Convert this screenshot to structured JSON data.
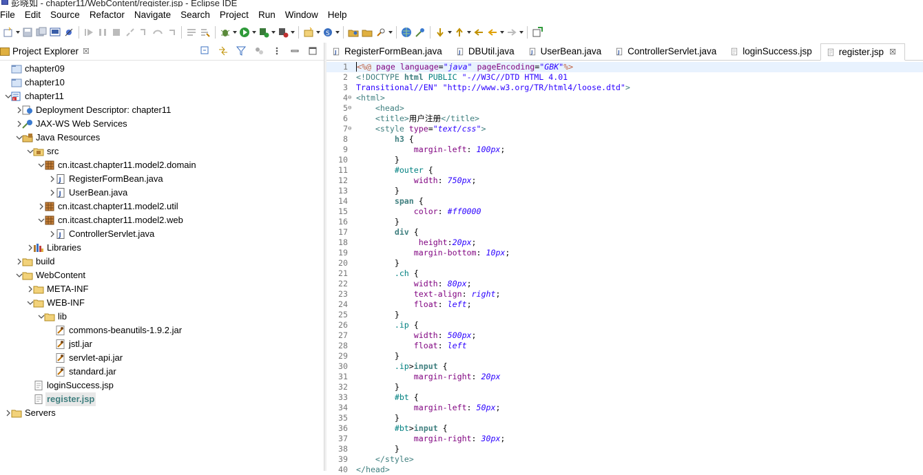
{
  "window": {
    "title": "彭晓如 - chapter11/WebContent/register.jsp - Eclipse IDE"
  },
  "menu": [
    "File",
    "Edit",
    "Source",
    "Refactor",
    "Navigate",
    "Search",
    "Project",
    "Run",
    "Window",
    "Help"
  ],
  "explorer": {
    "title": "Project Explorer",
    "close": "☒",
    "tree": [
      {
        "label": "chapter09",
        "icon": "project-folder",
        "level": 0,
        "toggle": ""
      },
      {
        "label": "chapter10",
        "icon": "project-folder",
        "level": 0,
        "toggle": ""
      },
      {
        "label": "chapter11",
        "icon": "web-project",
        "level": 0,
        "toggle": "v"
      },
      {
        "label": "Deployment Descriptor: chapter11",
        "icon": "descriptor",
        "level": 1,
        "toggle": ">"
      },
      {
        "label": "JAX-WS Web Services",
        "icon": "web-services",
        "level": 1,
        "toggle": ">"
      },
      {
        "label": "Java Resources",
        "icon": "java-resources",
        "level": 1,
        "toggle": "v"
      },
      {
        "label": "src",
        "icon": "source-folder",
        "level": 2,
        "toggle": "v"
      },
      {
        "label": "cn.itcast.chapter11.model2.domain",
        "icon": "package",
        "level": 3,
        "toggle": "v"
      },
      {
        "label": "RegisterFormBean.java",
        "icon": "java-file",
        "level": 4,
        "toggle": ">"
      },
      {
        "label": "UserBean.java",
        "icon": "java-file",
        "level": 4,
        "toggle": ">"
      },
      {
        "label": "cn.itcast.chapter11.model2.util",
        "icon": "package",
        "level": 3,
        "toggle": ">"
      },
      {
        "label": "cn.itcast.chapter11.model2.web",
        "icon": "package",
        "level": 3,
        "toggle": "v"
      },
      {
        "label": "ControllerServlet.java",
        "icon": "java-file",
        "level": 4,
        "toggle": ">"
      },
      {
        "label": "Libraries",
        "icon": "libraries",
        "level": 2,
        "toggle": ">"
      },
      {
        "label": "build",
        "icon": "folder",
        "level": 1,
        "toggle": ">"
      },
      {
        "label": "WebContent",
        "icon": "folder",
        "level": 1,
        "toggle": "v"
      },
      {
        "label": "META-INF",
        "icon": "folder",
        "level": 2,
        "toggle": ">"
      },
      {
        "label": "WEB-INF",
        "icon": "folder",
        "level": 2,
        "toggle": "v"
      },
      {
        "label": "lib",
        "icon": "folder",
        "level": 3,
        "toggle": "v"
      },
      {
        "label": "commons-beanutils-1.9.2.jar",
        "icon": "jar",
        "level": 4,
        "toggle": ""
      },
      {
        "label": "jstl.jar",
        "icon": "jar",
        "level": 4,
        "toggle": ""
      },
      {
        "label": "servlet-api.jar",
        "icon": "jar",
        "level": 4,
        "toggle": ""
      },
      {
        "label": "standard.jar",
        "icon": "jar",
        "level": 4,
        "toggle": ""
      },
      {
        "label": "loginSuccess.jsp",
        "icon": "jsp-file",
        "level": 2,
        "toggle": ""
      },
      {
        "label": "register.jsp",
        "icon": "jsp-file",
        "level": 2,
        "toggle": "",
        "selected": true
      },
      {
        "label": "Servers",
        "icon": "folder",
        "level": 0,
        "toggle": ">"
      }
    ]
  },
  "tabs": [
    {
      "label": "RegisterFormBean.java",
      "icon": "java-file"
    },
    {
      "label": "DBUtil.java",
      "icon": "java-file"
    },
    {
      "label": "UserBean.java",
      "icon": "java-file"
    },
    {
      "label": "ControllerServlet.java",
      "icon": "java-file"
    },
    {
      "label": "loginSuccess.jsp",
      "icon": "jsp-file"
    },
    {
      "label": "register.jsp",
      "icon": "jsp-file",
      "active": true,
      "close": "☒"
    }
  ],
  "code": [
    {
      "n": "1",
      "f": "",
      "tokens": [
        [
          "jsp",
          "<%@ "
        ],
        [
          "a",
          "page "
        ],
        [
          "prop",
          "language"
        ],
        [
          "d",
          "="
        ],
        [
          "val",
          "\"java\" "
        ],
        [
          "prop",
          "pageEncoding"
        ],
        [
          "d",
          "="
        ],
        [
          "val",
          "\"GBK\""
        ],
        [
          "jsp",
          "%>"
        ]
      ]
    },
    {
      "n": "2",
      "f": "",
      "tokens": [
        [
          "t",
          "<!DOCTYPE "
        ],
        [
          "sel",
          "html "
        ],
        [
          "dt",
          "PUBLIC "
        ],
        [
          "s2",
          "\"-//W3C//DTD HTML 4.01"
        ]
      ]
    },
    {
      "n": "3",
      "f": "",
      "tokens": [
        [
          "s2",
          "Transitional//EN\" \"http://www.w3.org/TR/html4/loose.dtd\""
        ],
        [
          "t",
          ">"
        ]
      ]
    },
    {
      "n": "4",
      "f": "⊖",
      "tokens": [
        [
          "t",
          "<html>"
        ]
      ]
    },
    {
      "n": "5",
      "f": "⊖",
      "tokens": [
        [
          "d",
          "    "
        ],
        [
          "t",
          "<head>"
        ]
      ]
    },
    {
      "n": "6",
      "f": "",
      "tokens": [
        [
          "d",
          "    "
        ],
        [
          "t",
          "<title>"
        ],
        [
          "d",
          "用户注册"
        ],
        [
          "t",
          "</title>"
        ]
      ]
    },
    {
      "n": "7",
      "f": "⊖",
      "tokens": [
        [
          "d",
          "    "
        ],
        [
          "t",
          "<style "
        ],
        [
          "prop",
          "type"
        ],
        [
          "d",
          "="
        ],
        [
          "val",
          "\"text/css\""
        ],
        [
          "t",
          ">"
        ]
      ]
    },
    {
      "n": "8",
      "f": "",
      "tokens": [
        [
          "d",
          "        "
        ],
        [
          "sel",
          "h3 "
        ],
        [
          "d",
          "{"
        ]
      ]
    },
    {
      "n": "9",
      "f": "",
      "tokens": [
        [
          "d",
          "            "
        ],
        [
          "prop",
          "margin-left"
        ],
        [
          "d",
          ": "
        ],
        [
          "val",
          "100px"
        ],
        [
          "d",
          ";"
        ]
      ]
    },
    {
      "n": "10",
      "f": "",
      "tokens": [
        [
          "d",
          "        }"
        ]
      ]
    },
    {
      "n": "11",
      "f": "",
      "tokens": [
        [
          "d",
          "        "
        ],
        [
          "dt",
          "#outer "
        ],
        [
          "d",
          "{"
        ]
      ]
    },
    {
      "n": "12",
      "f": "",
      "tokens": [
        [
          "d",
          "            "
        ],
        [
          "prop",
          "width"
        ],
        [
          "d",
          ": "
        ],
        [
          "val",
          "750px"
        ],
        [
          "d",
          ";"
        ]
      ]
    },
    {
      "n": "13",
      "f": "",
      "tokens": [
        [
          "d",
          "        }"
        ]
      ]
    },
    {
      "n": "14",
      "f": "",
      "tokens": [
        [
          "d",
          "        "
        ],
        [
          "sel",
          "span "
        ],
        [
          "d",
          "{"
        ]
      ]
    },
    {
      "n": "15",
      "f": "",
      "tokens": [
        [
          "d",
          "            "
        ],
        [
          "prop",
          "color"
        ],
        [
          "d",
          ": "
        ],
        [
          "val",
          "#ff0000"
        ]
      ]
    },
    {
      "n": "16",
      "f": "",
      "tokens": [
        [
          "d",
          "        }"
        ]
      ]
    },
    {
      "n": "17",
      "f": "",
      "tokens": [
        [
          "d",
          "        "
        ],
        [
          "sel",
          "div "
        ],
        [
          "d",
          "{"
        ]
      ]
    },
    {
      "n": "18",
      "f": "",
      "tokens": [
        [
          "d",
          "             "
        ],
        [
          "prop",
          "height"
        ],
        [
          "d",
          ":"
        ],
        [
          "val",
          "20px"
        ],
        [
          "d",
          ";"
        ]
      ]
    },
    {
      "n": "19",
      "f": "",
      "tokens": [
        [
          "d",
          "            "
        ],
        [
          "prop",
          "margin-bottom"
        ],
        [
          "d",
          ": "
        ],
        [
          "val",
          "10px"
        ],
        [
          "d",
          ";"
        ]
      ]
    },
    {
      "n": "20",
      "f": "",
      "tokens": [
        [
          "d",
          "        }"
        ]
      ]
    },
    {
      "n": "21",
      "f": "",
      "tokens": [
        [
          "d",
          "        "
        ],
        [
          "dt",
          ".ch "
        ],
        [
          "d",
          "{"
        ]
      ]
    },
    {
      "n": "22",
      "f": "",
      "tokens": [
        [
          "d",
          "            "
        ],
        [
          "prop",
          "width"
        ],
        [
          "d",
          ": "
        ],
        [
          "val",
          "80px"
        ],
        [
          "d",
          ";"
        ]
      ]
    },
    {
      "n": "23",
      "f": "",
      "tokens": [
        [
          "d",
          "            "
        ],
        [
          "prop",
          "text-align"
        ],
        [
          "d",
          ": "
        ],
        [
          "val",
          "right"
        ],
        [
          "d",
          ";"
        ]
      ]
    },
    {
      "n": "24",
      "f": "",
      "tokens": [
        [
          "d",
          "            "
        ],
        [
          "prop",
          "float"
        ],
        [
          "d",
          ": "
        ],
        [
          "val",
          "left"
        ],
        [
          "d",
          ";"
        ]
      ]
    },
    {
      "n": "25",
      "f": "",
      "tokens": [
        [
          "d",
          "        }"
        ]
      ]
    },
    {
      "n": "26",
      "f": "",
      "tokens": [
        [
          "d",
          "        "
        ],
        [
          "dt",
          ".ip "
        ],
        [
          "d",
          "{"
        ]
      ]
    },
    {
      "n": "27",
      "f": "",
      "tokens": [
        [
          "d",
          "            "
        ],
        [
          "prop",
          "width"
        ],
        [
          "d",
          ": "
        ],
        [
          "val",
          "500px"
        ],
        [
          "d",
          ";"
        ]
      ]
    },
    {
      "n": "28",
      "f": "",
      "tokens": [
        [
          "d",
          "            "
        ],
        [
          "prop",
          "float"
        ],
        [
          "d",
          ": "
        ],
        [
          "val",
          "left"
        ]
      ]
    },
    {
      "n": "29",
      "f": "",
      "tokens": [
        [
          "d",
          "        }"
        ]
      ]
    },
    {
      "n": "30",
      "f": "",
      "tokens": [
        [
          "d",
          "        "
        ],
        [
          "dt",
          ".ip"
        ],
        [
          "d",
          ">"
        ],
        [
          "sel",
          "input "
        ],
        [
          "d",
          "{"
        ]
      ]
    },
    {
      "n": "31",
      "f": "",
      "tokens": [
        [
          "d",
          "            "
        ],
        [
          "prop",
          "margin-right"
        ],
        [
          "d",
          ": "
        ],
        [
          "val",
          "20px"
        ]
      ]
    },
    {
      "n": "32",
      "f": "",
      "tokens": [
        [
          "d",
          "        }"
        ]
      ]
    },
    {
      "n": "33",
      "f": "",
      "tokens": [
        [
          "d",
          "        "
        ],
        [
          "dt",
          "#bt "
        ],
        [
          "d",
          "{"
        ]
      ]
    },
    {
      "n": "34",
      "f": "",
      "tokens": [
        [
          "d",
          "            "
        ],
        [
          "prop",
          "margin-left"
        ],
        [
          "d",
          ": "
        ],
        [
          "val",
          "50px"
        ],
        [
          "d",
          ";"
        ]
      ]
    },
    {
      "n": "35",
      "f": "",
      "tokens": [
        [
          "d",
          "        }"
        ]
      ]
    },
    {
      "n": "36",
      "f": "",
      "tokens": [
        [
          "d",
          "        "
        ],
        [
          "dt",
          "#bt"
        ],
        [
          "d",
          ">"
        ],
        [
          "sel",
          "input "
        ],
        [
          "d",
          "{"
        ]
      ]
    },
    {
      "n": "37",
      "f": "",
      "tokens": [
        [
          "d",
          "            "
        ],
        [
          "prop",
          "margin-right"
        ],
        [
          "d",
          ": "
        ],
        [
          "val",
          "30px"
        ],
        [
          "d",
          ";"
        ]
      ]
    },
    {
      "n": "38",
      "f": "",
      "tokens": [
        [
          "d",
          "        }"
        ]
      ]
    },
    {
      "n": "39",
      "f": "",
      "tokens": [
        [
          "d",
          "    "
        ],
        [
          "t",
          "</style>"
        ]
      ]
    },
    {
      "n": "40",
      "f": "",
      "tokens": [
        [
          "t",
          "</head>"
        ]
      ]
    }
  ],
  "colors": {
    "tag": "#3f7f7f",
    "attr": "#7f007f",
    "value": "#2a00ff",
    "jsp": "#bf5f3f",
    "selector": "#3f7f7f",
    "current_line": "#e8f2fe"
  }
}
